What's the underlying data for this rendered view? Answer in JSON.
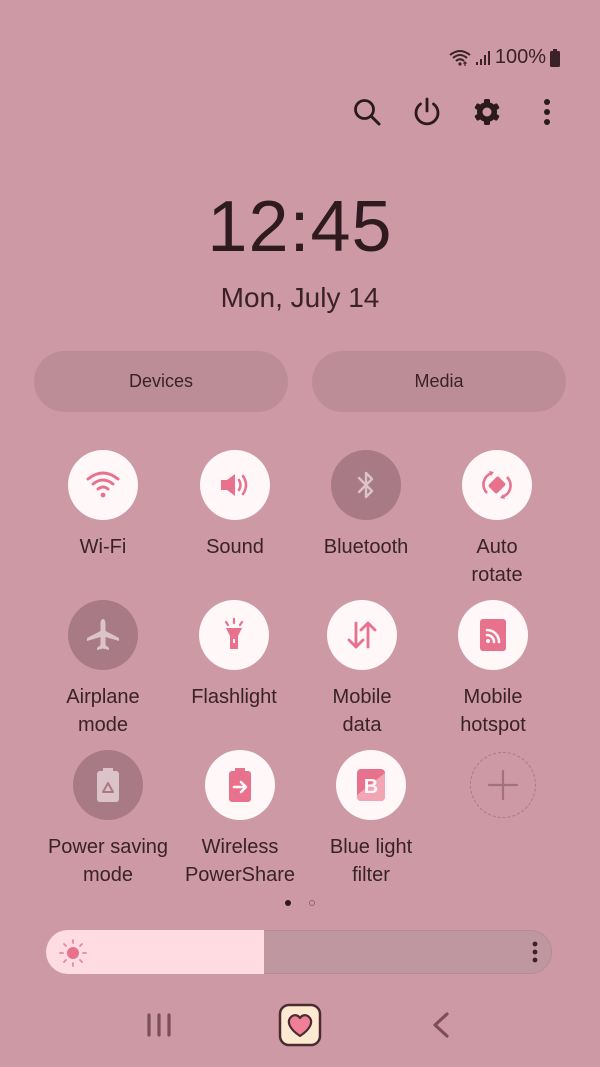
{
  "status_bar": {
    "wifi_icon": "wifi-icon",
    "signal_icon": "signal-icon",
    "battery_percent": "100%",
    "battery_icon": "battery-icon"
  },
  "top_actions": [
    {
      "name": "search",
      "icon": "search-icon"
    },
    {
      "name": "power",
      "icon": "power-icon"
    },
    {
      "name": "settings",
      "icon": "gear-icon"
    },
    {
      "name": "more",
      "icon": "more-vertical-icon"
    }
  ],
  "clock": {
    "time": "12:45",
    "date": "Mon, July 14"
  },
  "pills": {
    "devices": "Devices",
    "media": "Media"
  },
  "tiles": [
    {
      "id": "wifi",
      "line1": "Wi-Fi",
      "line2": "",
      "state": "on",
      "icon": "wifi-icon"
    },
    {
      "id": "sound",
      "line1": "Sound",
      "line2": "",
      "state": "on",
      "icon": "speaker-icon"
    },
    {
      "id": "bluetooth",
      "line1": "Bluetooth",
      "line2": "",
      "state": "off",
      "icon": "bluetooth-icon"
    },
    {
      "id": "auto-rotate",
      "line1": "Auto",
      "line2": "rotate",
      "state": "on",
      "icon": "rotate-icon"
    },
    {
      "id": "airplane",
      "line1": "Airplane",
      "line2": "mode",
      "state": "off",
      "icon": "airplane-icon"
    },
    {
      "id": "flashlight",
      "line1": "Flashlight",
      "line2": "",
      "state": "on",
      "icon": "flashlight-icon"
    },
    {
      "id": "mobile-data",
      "line1": "Mobile",
      "line2": "data",
      "state": "on",
      "icon": "data-arrows-icon"
    },
    {
      "id": "hotspot",
      "line1": "Mobile",
      "line2": "hotspot",
      "state": "on",
      "icon": "hotspot-icon"
    },
    {
      "id": "power-saving",
      "line1": "Power saving",
      "line2": "mode",
      "state": "off",
      "icon": "battery-recycle-icon"
    },
    {
      "id": "powershare",
      "line1": "Wireless",
      "line2": "PowerShare",
      "state": "on",
      "icon": "battery-share-icon"
    },
    {
      "id": "blue-light",
      "line1": "Blue light",
      "line2": "filter",
      "state": "on",
      "icon": "blue-light-icon"
    },
    {
      "id": "add",
      "line1": "",
      "line2": "",
      "state": "add",
      "icon": "plus-icon"
    }
  ],
  "pagination": {
    "current": 1,
    "total": 2
  },
  "brightness": {
    "level_percent": 43,
    "icon": "sun-icon",
    "more_icon": "more-vertical-icon"
  },
  "nav": {
    "recents": "recents-icon",
    "home": "heart-home-icon",
    "back": "back-icon"
  },
  "colors": {
    "background": "#cc99a5",
    "accent": "#e8728e",
    "tile_on": "#fff7f8",
    "tile_off": "#a87a85",
    "text": "#3a2228"
  }
}
